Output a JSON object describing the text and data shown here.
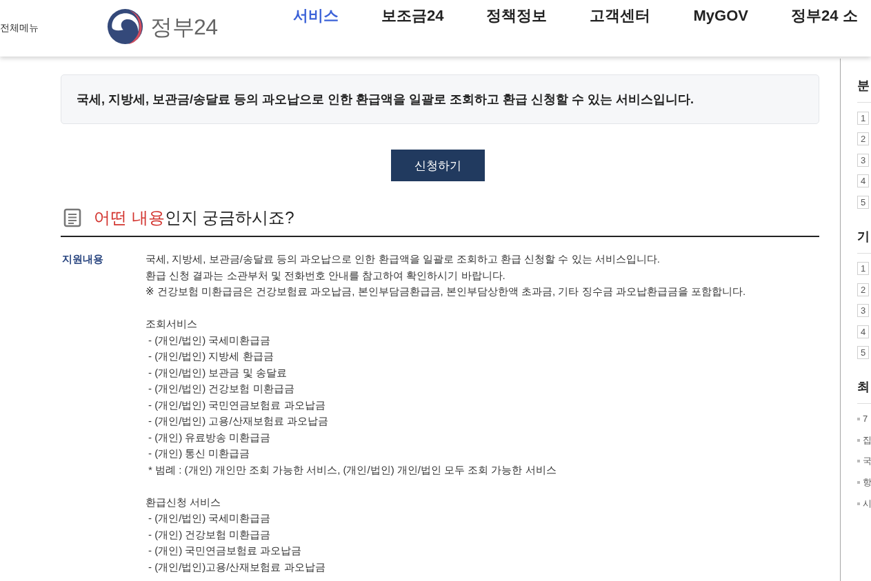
{
  "header": {
    "menu_label": "전체메뉴",
    "logo": {
      "text": "정부24"
    },
    "nav": [
      {
        "label": "서비스",
        "selected": true
      },
      {
        "label": "보조금24",
        "selected": false
      },
      {
        "label": "정책정보",
        "selected": false
      },
      {
        "label": "고객센터",
        "selected": false
      },
      {
        "label": "MyGOV",
        "selected": false
      },
      {
        "label": "정부24 소",
        "selected": false
      }
    ]
  },
  "summary": {
    "text": "국세, 지방세, 보관금/송달료 등의 과오납으로 인한 환급액을 일괄로 조회하고 환급 신청할 수 있는 서비스입니다."
  },
  "apply_button": {
    "label": "신청하기"
  },
  "section": {
    "title_highlight": "어떤 내용",
    "title_rest": "인지 궁금하시죠?",
    "rows": [
      {
        "label": "지원내용",
        "intro": [
          "국세, 지방세, 보관금/송달료 등의 과오납으로 인한 환급액을 일괄로 조회하고 환급 신청할 수 있는 서비스입니다.",
          "환급 신청 결과는 소관부처 및 전화번호 안내를 참고하여 확인하시기 바랍니다.",
          "※ 건강보험 미환급금은 건강보험료 과오납금, 본인부담금환급금, 본인부담상한액 초과금, 기타 징수금 과오납환급금을 포함합니다."
        ],
        "groups": [
          {
            "title": "조회서비스",
            "items": [
              "- (개인/법인) 국세미환급금",
              "- (개인/법인) 지방세 환급금",
              "- (개인/법인) 보관금 및 송달료",
              "- (개인/법인) 건강보험 미환급금",
              "- (개인/법인) 국민연금보험료 과오납금",
              "- (개인/법인) 고용/산재보험료 과오납금",
              "- (개인) 유료방송 미환급금",
              "- (개인) 통신 미환급금"
            ],
            "note": "* 범례 : (개인) 개인만 조회 가능한 서비스, (개인/법인) 개인/법인 모두 조회 가능한 서비스"
          },
          {
            "title": "환급신청 서비스",
            "items": [
              "- (개인/법인) 국세미환급금",
              "- (개인) 건강보험 미환급금",
              "- (개인) 국민연금보험료 과오납금",
              "- (개인/법인)고용/산재보험료 과오납금"
            ]
          }
        ]
      }
    ]
  },
  "sidebar": {
    "sections": [
      {
        "title": "분",
        "kind": "ranked",
        "items": [
          "1",
          "2",
          "3",
          "4",
          "5"
        ]
      },
      {
        "title": "기",
        "kind": "ranked",
        "items": [
          "1",
          "2",
          "3",
          "4",
          "5"
        ]
      },
      {
        "title": "최",
        "kind": "bulleted",
        "items": [
          "7",
          "집",
          "국",
          "항",
          "시"
        ]
      }
    ]
  }
}
